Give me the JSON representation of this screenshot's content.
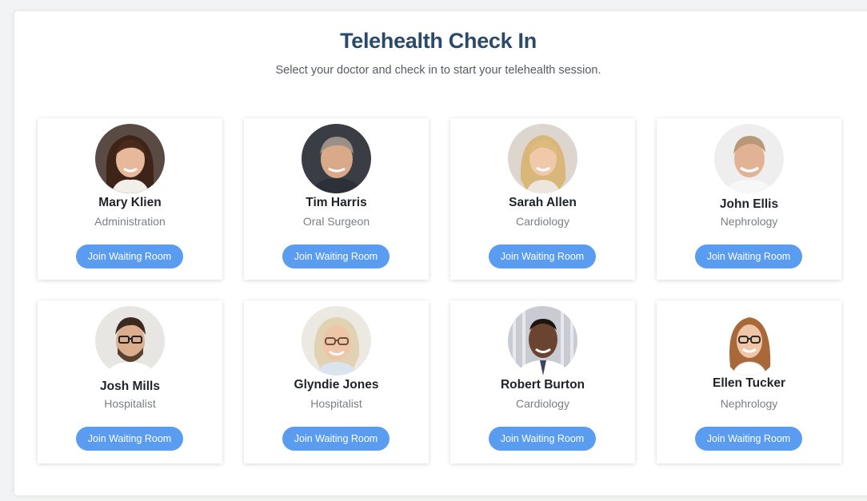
{
  "header": {
    "title": "Telehealth Check In",
    "subtitle": "Select your doctor and check in to start your telehealth session."
  },
  "colors": {
    "accent": "#5a9cf0",
    "title": "#2a4a6a"
  },
  "doctors": [
    {
      "name": "Mary Klien",
      "department": "Administration",
      "button_label": "Join Waiting Room",
      "avatar_icon": "doctor-photo-female-brunette"
    },
    {
      "name": "Tim Harris",
      "department": "Oral Surgeon",
      "button_label": "Join Waiting Room",
      "avatar_icon": "doctor-photo-male-grey-hair"
    },
    {
      "name": "Sarah Allen",
      "department": "Cardiology",
      "button_label": "Join Waiting Room",
      "avatar_icon": "doctor-photo-female-blonde"
    },
    {
      "name": "John Ellis",
      "department": "Nephrology",
      "button_label": "Join Waiting Room",
      "avatar_icon": "doctor-photo-male-light-hair"
    },
    {
      "name": "Josh Mills",
      "department": "Hospitalist",
      "button_label": "Join Waiting Room",
      "avatar_icon": "doctor-photo-male-glasses"
    },
    {
      "name": "Glyndie Jones",
      "department": "Hospitalist",
      "button_label": "Join Waiting Room",
      "avatar_icon": "doctor-photo-female-grey-glasses"
    },
    {
      "name": "Robert Burton",
      "department": "Cardiology",
      "button_label": "Join Waiting Room",
      "avatar_icon": "doctor-photo-male-dark-skin"
    },
    {
      "name": "Ellen Tucker",
      "department": "Nephrology",
      "button_label": "Join Waiting Room",
      "avatar_icon": "doctor-photo-female-glasses"
    }
  ]
}
